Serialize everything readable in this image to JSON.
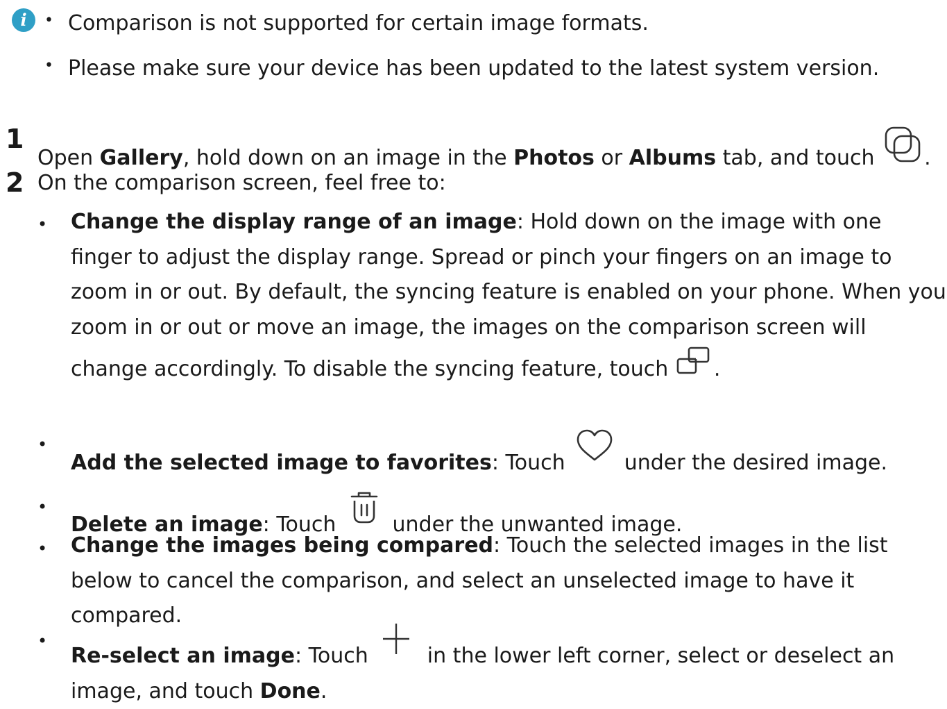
{
  "notes": {
    "items": [
      "Comparison is not supported for certain image formats.",
      "Please make sure your device has been updated to the latest system version."
    ]
  },
  "icons": {
    "info": "info-icon",
    "compare": "compare-icon",
    "sync": "sync-icon",
    "favorite": "heart-icon",
    "delete": "trash-icon",
    "add": "plus-icon",
    "info_color": "#2f9fc6"
  },
  "steps": {
    "step1": {
      "number": "1",
      "t1": "Open ",
      "b1": "Gallery",
      "t2": ", hold down on an image in the ",
      "b2": "Photos",
      "t3": " or ",
      "b3": "Albums",
      "t4": " tab, and touch ",
      "t5": "."
    },
    "step2": {
      "number": "2",
      "text": "On the comparison screen, feel free to:"
    }
  },
  "bullets": {
    "display_range": {
      "title": "Change the display range of an image",
      "text": ": Hold down on the image with one finger to adjust the display range. Spread or pinch your fingers on an image to zoom in or out. By default, the syncing feature is enabled on your phone. When you zoom in or out or move an image, the images on the comparison screen will change accordingly. To disable the syncing feature, touch ",
      "end": "."
    },
    "favorites": {
      "title": "Add the selected image to favorites",
      "t1": ": Touch ",
      "t2": " under the desired image."
    },
    "delete": {
      "title": "Delete an image",
      "t1": ": Touch ",
      "t2": " under the unwanted image."
    },
    "change": {
      "title": "Change the images being compared",
      "text": ": Touch the selected images in the list below to cancel the comparison, and select an unselected image to have it compared."
    },
    "reselect": {
      "title": "Re-select an image",
      "t1": ": Touch ",
      "t2": " in the lower left corner, select or deselect an image, and touch ",
      "b": "Done",
      "end": "."
    }
  }
}
